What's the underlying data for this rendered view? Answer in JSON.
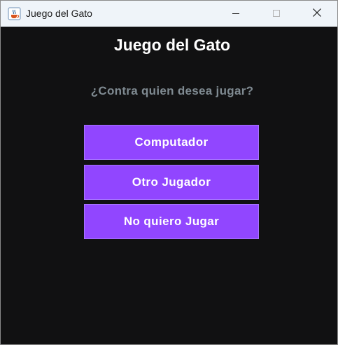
{
  "window": {
    "title": "Juego del Gato",
    "app_icon": "java-cup-icon",
    "controls": [
      "minimize-icon",
      "maximize-icon",
      "close-icon"
    ]
  },
  "main": {
    "heading": "Juego del Gato",
    "question": "¿Contra quien desea jugar?",
    "buttons": [
      {
        "label": "Computador"
      },
      {
        "label": "Otro Jugador"
      },
      {
        "label": "No quiero Jugar"
      }
    ]
  },
  "colors": {
    "background": "#111112",
    "button": "#9146ff",
    "question_text": "#7f8a91",
    "heading_text": "#ffffff",
    "titlebar": "#eff4f9"
  }
}
